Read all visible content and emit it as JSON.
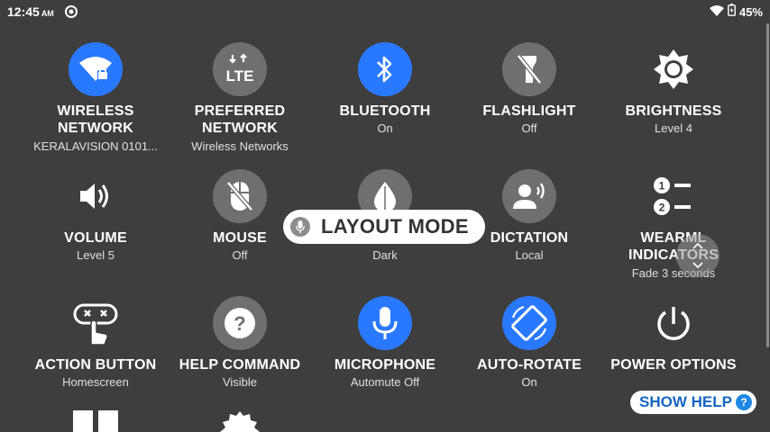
{
  "status_bar": {
    "time": "12:45",
    "ampm": "AM",
    "battery": "45%"
  },
  "tiles": [
    {
      "name": "WIRELESS NETWORK",
      "name_lines": [
        "WIRELESS",
        "NETWORK"
      ],
      "sub": "KERALAVISION 0101...",
      "icon": "wifi-lock-icon",
      "style": "blue"
    },
    {
      "name": "PREFERRED NETWORK",
      "name_lines": [
        "PREFERRED",
        "NETWORK"
      ],
      "sub": "Wireless Networks",
      "icon": "lte-icon",
      "style": "gray"
    },
    {
      "name": "BLUETOOTH",
      "sub": "On",
      "icon": "bluetooth-icon",
      "style": "blue"
    },
    {
      "name": "FLASHLIGHT",
      "sub": "Off",
      "icon": "flashlight-off-icon",
      "style": "gray"
    },
    {
      "name": "BRIGHTNESS",
      "sub": "Level 4",
      "icon": "brightness-icon",
      "style": "none"
    },
    {
      "name": "VOLUME",
      "sub": "Level 5",
      "icon": "volume-icon",
      "style": "none"
    },
    {
      "name": "MOUSE",
      "sub": "Off",
      "icon": "mouse-off-icon",
      "style": "gray"
    },
    {
      "name": "",
      "sub": "Dark",
      "icon": "theme-drop-icon",
      "style": "gray"
    },
    {
      "name": "DICTATION",
      "sub": "Local",
      "icon": "dictation-icon",
      "style": "gray"
    },
    {
      "name": "WEARML INDICATORS",
      "name_lines": [
        "WEARML",
        "INDICATORS"
      ],
      "sub": "Fade 3 seconds",
      "icon": "numbered-list-icon",
      "style": "none"
    },
    {
      "name": "ACTION BUTTON",
      "sub": "Homescreen",
      "icon": "action-button-icon",
      "style": "none"
    },
    {
      "name": "HELP COMMAND",
      "sub": "Visible",
      "icon": "help-icon",
      "style": "gray"
    },
    {
      "name": "MICROPHONE",
      "sub": "Automute Off",
      "icon": "microphone-icon",
      "style": "blue"
    },
    {
      "name": "AUTO-ROTATE",
      "sub": "On",
      "icon": "auto-rotate-icon",
      "style": "blue"
    },
    {
      "name": "POWER OPTIONS",
      "sub": "",
      "icon": "power-icon",
      "style": "none"
    }
  ],
  "overlay": {
    "layout_mode": "LAYOUT MODE"
  },
  "help": {
    "label": "SHOW HELP",
    "badge": "?"
  },
  "colors": {
    "background": "#3e3e3e",
    "accent": "#2979ff",
    "tile_gray": "#6f6f6f"
  }
}
